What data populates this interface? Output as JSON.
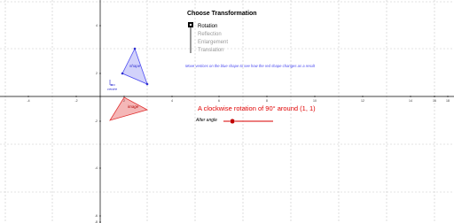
{
  "panel": {
    "title": "Choose Transformation",
    "options": [
      "Rotation",
      "Reflection",
      "Enlargement",
      "Translation"
    ],
    "selected_index": 0
  },
  "instruction": "Move vertices on the blue shape to see how the red shape changes as a result",
  "description": "A clockwise rotation of 90° around (1, 1)",
  "slider": {
    "label": "Alter angle",
    "value_fraction": 0.18
  },
  "shapes": {
    "blue_name": "shape",
    "red_name": "image",
    "blue_color": "#4a4af0",
    "red_color": "#e03030"
  },
  "origin_label": "centre",
  "axes": {
    "x_ticks": [
      "-4",
      "-2",
      "2",
      "4",
      "6",
      "8",
      "10",
      "12",
      "14",
      "16",
      "18"
    ],
    "y_ticks": [
      "4",
      "2",
      "-2",
      "-4",
      "-6",
      "-8"
    ]
  },
  "colors": {
    "grid": "#c8c8c8",
    "axis": "#000000",
    "accent": "#e00000"
  }
}
